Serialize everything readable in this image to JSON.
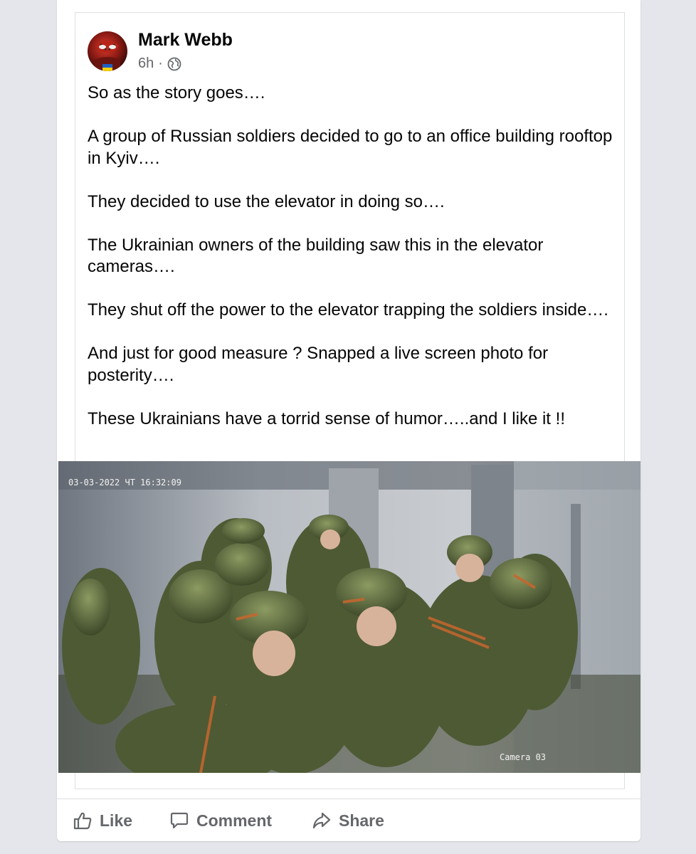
{
  "post": {
    "author": "Mark Webb",
    "time": "6h",
    "separator": "·",
    "privacy_icon": "globe-icon",
    "paragraphs": [
      "So as the story goes….",
      "A group of Russian soldiers decided to go to an office building rooftop in Kyiv….",
      "They decided to use the elevator in doing so….",
      "The Ukrainian owners of the building saw this in the elevator cameras….",
      "They shut off the power to the elevator trapping the soldiers inside….",
      "And just for good measure ? Snapped a live screen photo for posterity….",
      "These Ukrainians have a torrid sense of humor…..and I like it !!"
    ]
  },
  "photo": {
    "timestamp": "03-03-2022 ЧТ 16:32:09",
    "camera_label": "Camera 03"
  },
  "actions": {
    "like": "Like",
    "comment": "Comment",
    "share": "Share"
  },
  "colors": {
    "background": "#e4e6eb",
    "card": "#ffffff",
    "secondary_text": "#65676b"
  }
}
